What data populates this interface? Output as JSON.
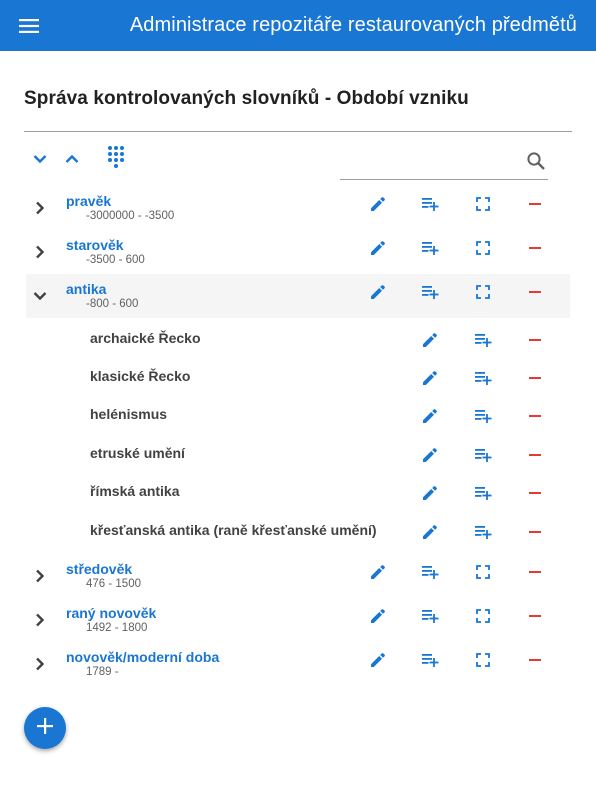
{
  "app": {
    "title": "Administrace repozitáře restaurovaných předmětů"
  },
  "page": {
    "title": "Správa kontrolovaných slovníků - Období vzniku"
  },
  "toolbar": {
    "icons": [
      "chevron-down-icon",
      "chevron-up-icon",
      "dialpad-icon"
    ]
  },
  "search": {
    "value": "",
    "placeholder": ""
  },
  "colors": {
    "primary": "#1976d2",
    "danger": "#e53935",
    "selected_row": "#f5f5f5"
  },
  "tree": [
    {
      "label": "pravěk",
      "range": "-3000000 - -3500",
      "expanded": false
    },
    {
      "label": "starověk",
      "range": "-3500 - 600",
      "expanded": false
    },
    {
      "label": "antika",
      "range": "-800 - 600",
      "expanded": true,
      "children": [
        {
          "label": "archaické Řecko"
        },
        {
          "label": "klasické Řecko"
        },
        {
          "label": "helénismus"
        },
        {
          "label": "etruské umění"
        },
        {
          "label": "římská antika"
        },
        {
          "label": "křesťanská antika (raně křesťanské umění)"
        }
      ]
    },
    {
      "label": "středověk",
      "range": "476 - 1500",
      "expanded": false
    },
    {
      "label": "raný novověk",
      "range": "1492 - 1800",
      "expanded": false
    },
    {
      "label": "novověk/moderní doba",
      "range": "1789 - ",
      "expanded": false
    }
  ],
  "row_actions": [
    "edit-icon",
    "playlist-add-icon",
    "fullscreen-icon",
    "remove-icon"
  ],
  "child_actions": [
    "edit-icon",
    "playlist-add-icon",
    "remove-icon"
  ],
  "fab": {
    "icon": "add-icon"
  }
}
